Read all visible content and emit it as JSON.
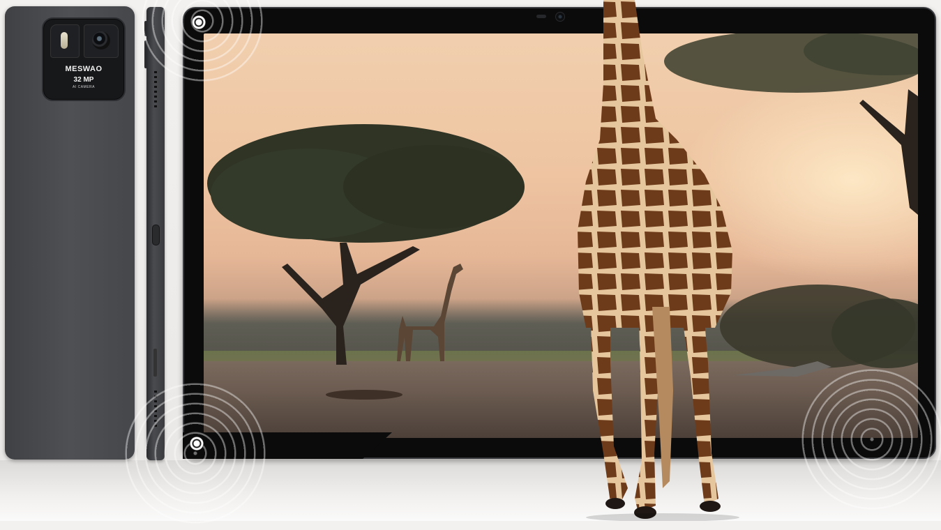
{
  "product": {
    "brand": "MESWAO",
    "camera_spec": "32 MP",
    "camera_sub": "AI CAMERA"
  },
  "colors": {
    "device_body": "#45474b",
    "bezel": "#0b0b0c",
    "sky_top": "#f1cfae",
    "ground": "#6b5b50",
    "giraffe": "#8a5a2e"
  },
  "icons": {
    "rear_camera": "camera-lens-icon",
    "flash": "flash-icon",
    "front_camera": "front-camera-icon",
    "usb_port": "usb-c-port-icon",
    "speaker": "speaker-ripple-icon"
  }
}
